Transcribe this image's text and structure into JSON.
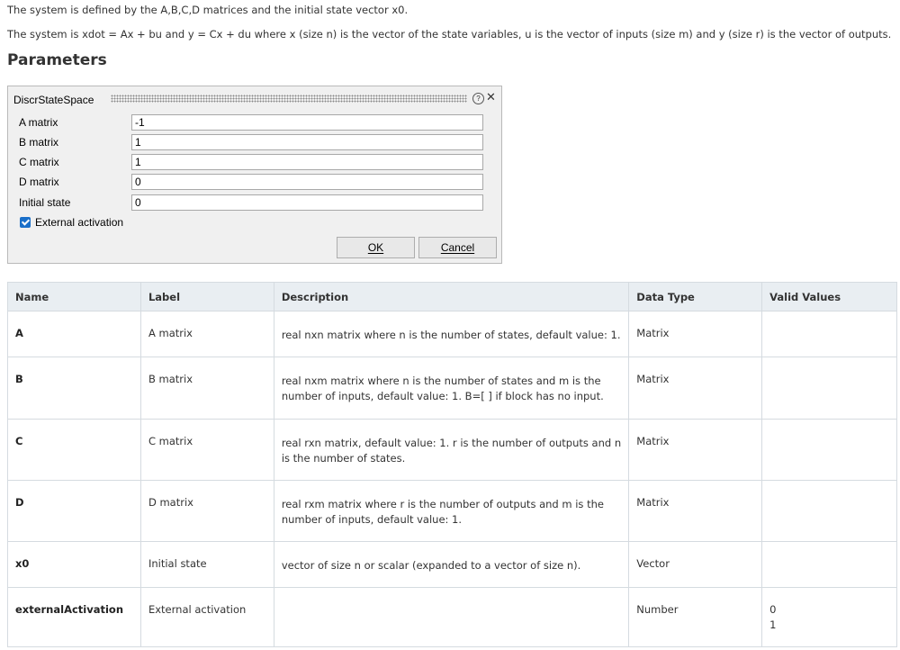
{
  "intro": {
    "line1": "The system is defined by the A,B,C,D matrices and the initial state vector x0.",
    "line2": "The system is xdot = Ax + bu and y = Cx + du where x (size n) is the vector of the state variables, u is the vector of inputs (size m) and y (size r) is the vector of outputs."
  },
  "heading": "Parameters",
  "dialog": {
    "title": "DiscrStateSpace",
    "help_icon": "help-circle-icon",
    "help_glyph": "?",
    "close_icon": "close-icon",
    "close_glyph": "✕",
    "fields": [
      {
        "label": "A matrix",
        "value": "-1"
      },
      {
        "label": "B matrix",
        "value": "1"
      },
      {
        "label": "C matrix",
        "value": "1"
      },
      {
        "label": "D matrix",
        "value": "0"
      },
      {
        "label": "Initial state",
        "value": "0"
      }
    ],
    "checkbox": {
      "label": "External activation",
      "checked": true,
      "color": "#1a6fc9"
    },
    "ok_label": "OK",
    "cancel_label": "Cancel"
  },
  "table": {
    "headers": [
      "Name",
      "Label",
      "Description",
      "Data Type",
      "Valid Values"
    ],
    "rows": [
      {
        "name": "A",
        "label": "A matrix",
        "description": "real nxn matrix where n is the number of states, default value: 1.",
        "data_type": "Matrix",
        "valid_values": []
      },
      {
        "name": "B",
        "label": "B matrix",
        "description": "real nxm matrix where n is the number of states and m is the number of inputs, default value: 1. B=[ ] if block has no input.",
        "data_type": "Matrix",
        "valid_values": []
      },
      {
        "name": "C",
        "label": "C matrix",
        "description": "real rxn matrix, default value: 1. r is the number of outputs and n is the number of states.",
        "data_type": "Matrix",
        "valid_values": []
      },
      {
        "name": "D",
        "label": "D matrix",
        "description": "real rxm matrix where r is the number of outputs and m is the number of inputs, default value: 1.",
        "data_type": "Matrix",
        "valid_values": []
      },
      {
        "name": "x0",
        "label": "Initial state",
        "description": "vector of size n or scalar (expanded to a vector of size n).",
        "data_type": "Vector",
        "valid_values": []
      },
      {
        "name": "externalActivation",
        "label": "External activation",
        "description": "",
        "data_type": "Number",
        "valid_values": [
          "0",
          "1"
        ]
      }
    ]
  }
}
